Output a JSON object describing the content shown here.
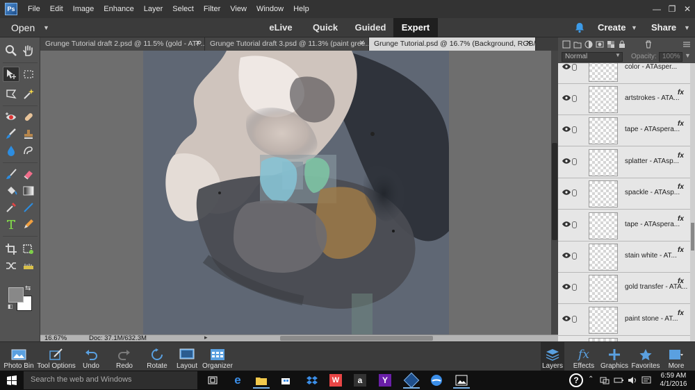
{
  "menu": [
    "File",
    "Edit",
    "Image",
    "Enhance",
    "Layer",
    "Select",
    "Filter",
    "View",
    "Window",
    "Help"
  ],
  "window_controls": {
    "minimize": "—",
    "maximize": "❐",
    "close": "✕"
  },
  "modebar": {
    "open": "Open",
    "modes": [
      "eLive",
      "Quick",
      "Guided",
      "Expert"
    ],
    "active_mode": "Expert",
    "create": "Create",
    "share": "Share"
  },
  "doc_tabs": [
    {
      "title": "Grunge Tutorial draft 2.psd @ 11.5% (gold - ATP...",
      "active": false
    },
    {
      "title": "Grunge Tutorial draft 3.psd @ 11.3% (paint gree...",
      "active": false
    },
    {
      "title": "Grunge Tutorial.psd @ 16.7% (Background, RGB/8) *",
      "active": true
    }
  ],
  "status": {
    "zoom": "16.67%",
    "doc": "Doc: 37.1M/632.3M"
  },
  "layers_panel": {
    "blend_mode": "Normal",
    "opacity_label": "Opacity:",
    "opacity_value": "100%",
    "layers": [
      {
        "name": "color - ATAsper...",
        "fx": "fx"
      },
      {
        "name": "artstrokes - ATA...",
        "fx": "fx"
      },
      {
        "name": "tape - ATAspera...",
        "fx": "fx"
      },
      {
        "name": "splatter - ATAsp...",
        "fx": "fx"
      },
      {
        "name": "spackle - ATAsp...",
        "fx": "fx"
      },
      {
        "name": "tape - ATAspera...",
        "fx": "fx"
      },
      {
        "name": "stain white - AT...",
        "fx": "fx"
      },
      {
        "name": "gold transfer - ATA...",
        "fx": "fx"
      },
      {
        "name": "paint stone - AT...",
        "fx": "fx"
      }
    ]
  },
  "bottom_left": [
    {
      "label": "Photo Bin",
      "icon": "photo-bin-icon"
    },
    {
      "label": "Tool Options",
      "icon": "tool-options-icon"
    },
    {
      "label": "Undo",
      "icon": "undo-icon"
    },
    {
      "label": "Redo",
      "icon": "redo-icon"
    },
    {
      "label": "Rotate",
      "icon": "rotate-icon"
    },
    {
      "label": "Layout",
      "icon": "layout-icon"
    },
    {
      "label": "Organizer",
      "icon": "organizer-icon"
    }
  ],
  "bottom_right": [
    {
      "label": "Layers",
      "icon": "layers-icon"
    },
    {
      "label": "Effects",
      "icon": "effects-icon"
    },
    {
      "label": "Graphics",
      "icon": "graphics-icon"
    },
    {
      "label": "Favorites",
      "icon": "favorites-icon"
    },
    {
      "label": "More",
      "icon": "more-icon"
    }
  ],
  "taskbar": {
    "search_placeholder": "Search the web and Windows",
    "time": "6:59 AM",
    "date": "4/1/2016"
  }
}
